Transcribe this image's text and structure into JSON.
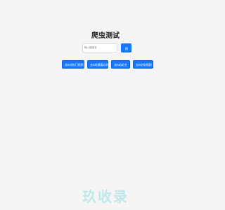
{
  "page": {
    "title": "爬虫测试"
  },
  "search": {
    "placeholder": "输入搜索关",
    "button_label": "搜索"
  },
  "actions": [
    {
      "label": "去B站热门视频"
    },
    {
      "label": "去B站猜喜欢的"
    },
    {
      "label": "去B站综艺"
    },
    {
      "label": "去B站电视剧"
    }
  ],
  "watermark": {
    "text": "玖收录"
  },
  "colors": {
    "background": "#f5f5f5",
    "accent": "#1677ff",
    "watermark": "#36c4c4"
  }
}
